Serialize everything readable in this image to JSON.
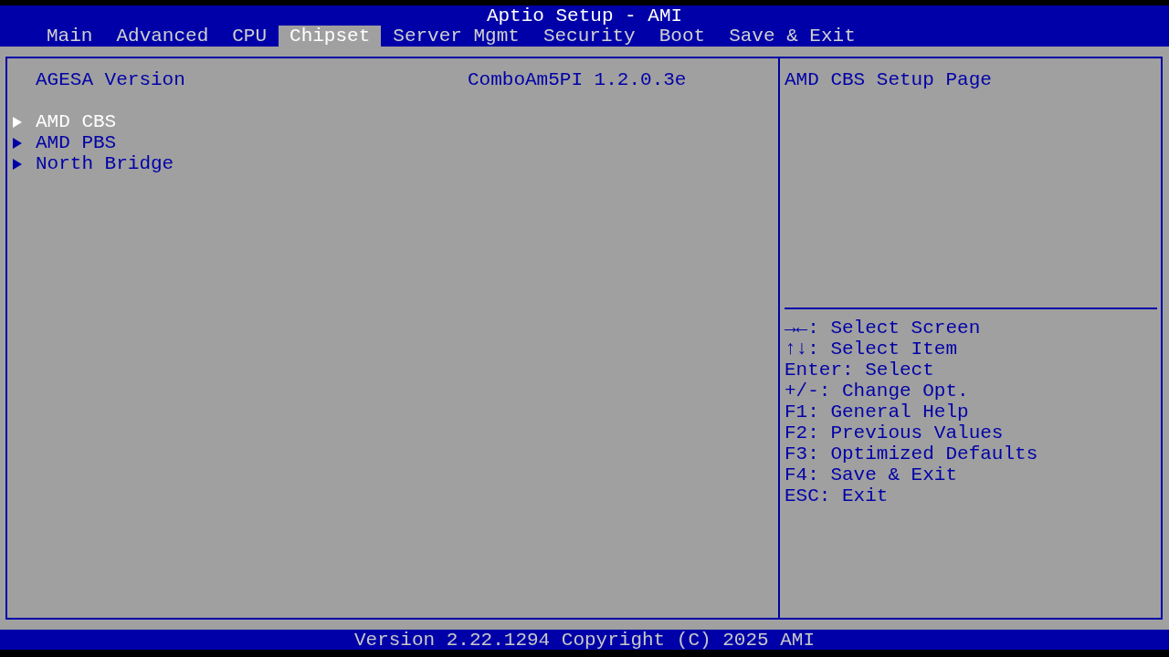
{
  "window": {
    "title": "Aptio Setup - AMI"
  },
  "tabs": [
    {
      "label": "Main",
      "selected": false
    },
    {
      "label": "Advanced",
      "selected": false
    },
    {
      "label": "CPU",
      "selected": false
    },
    {
      "label": "Chipset",
      "selected": true
    },
    {
      "label": "Server Mgmt",
      "selected": false
    },
    {
      "label": "Security",
      "selected": false
    },
    {
      "label": "Boot",
      "selected": false
    },
    {
      "label": "Save & Exit",
      "selected": false
    }
  ],
  "info": [
    {
      "label": "AGESA Version",
      "value": "ComboAm5PI 1.2.0.3e"
    }
  ],
  "menu_items": [
    {
      "label": "AMD CBS",
      "selected": true
    },
    {
      "label": "AMD PBS",
      "selected": false
    },
    {
      "label": "North Bridge",
      "selected": false
    }
  ],
  "help": {
    "text": "AMD CBS Setup Page",
    "hints": [
      "→←: Select Screen",
      "↑↓: Select Item",
      "Enter: Select",
      "+/-: Change Opt.",
      "F1: General Help",
      "F2: Previous Values",
      "F3: Optimized Defaults",
      "F4: Save & Exit",
      "ESC: Exit"
    ]
  },
  "status_bar": "Version 2.22.1294 Copyright (C) 2025 AMI"
}
